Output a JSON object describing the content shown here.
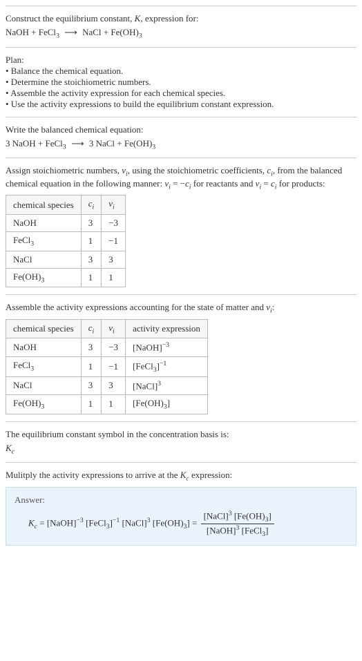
{
  "s1": {
    "line1_a": "Construct the equilibrium constant, ",
    "line1_b": ", expression for:",
    "K": "K",
    "eq_lhs1": "NaOH + FeCl",
    "eq_rhs1": "NaCl + Fe(OH)",
    "sub3": "3"
  },
  "s2": {
    "plan": "Plan:",
    "b1": "• Balance the chemical equation.",
    "b2": "• Determine the stoichiometric numbers.",
    "b3": "• Assemble the activity expression for each chemical species.",
    "b4": "• Use the activity expressions to build the equilibrium constant expression."
  },
  "s3": {
    "line1": "Write the balanced chemical equation:",
    "eq_lhs": "3 NaOH + FeCl",
    "eq_rhs": "3 NaCl + Fe(OH)",
    "sub3": "3"
  },
  "s4": {
    "line1a": "Assign stoichiometric numbers, ",
    "nu_i": "ν",
    "line1b": ", using the stoichiometric coefficients, ",
    "c_i": "c",
    "line1c": ", from the balanced chemical equation in the following manner: ",
    "rel_reactants_a": " = −",
    "line1d": " for reactants and ",
    "rel_products_a": " = ",
    "line1e": " for products:",
    "i": "i",
    "h1": "chemical species",
    "h2": "c",
    "h3": "ν",
    "r1": {
      "sp": "NaOH",
      "c": "3",
      "v": "−3"
    },
    "r2": {
      "sp_a": "FeCl",
      "c": "1",
      "v": "−1"
    },
    "r3": {
      "sp": "NaCl",
      "c": "3",
      "v": "3"
    },
    "r4": {
      "sp_a": "Fe(OH)",
      "c": "1",
      "v": "1"
    },
    "sub3": "3"
  },
  "s5": {
    "line1a": "Assemble the activity expressions accounting for the state of matter and ",
    "line1b": ":",
    "nu": "ν",
    "i": "i",
    "h1": "chemical species",
    "h2": "c",
    "h3": "ν",
    "h4": "activity expression",
    "r1": {
      "sp": "NaOH",
      "c": "3",
      "v": "−3",
      "ae_base": "[NaOH]",
      "ae_exp": "−3"
    },
    "r2": {
      "sp_a": "FeCl",
      "c": "1",
      "v": "−1",
      "ae_base_a": "[FeCl",
      "ae_base_b": "]",
      "ae_exp": "−1"
    },
    "r3": {
      "sp": "NaCl",
      "c": "3",
      "v": "3",
      "ae_base": "[NaCl]",
      "ae_exp": "3"
    },
    "r4": {
      "sp_a": "Fe(OH)",
      "c": "1",
      "v": "1",
      "ae_base_a": "[Fe(OH)",
      "ae_base_b": "]"
    },
    "sub3": "3"
  },
  "s6": {
    "line1": "The equilibrium constant symbol in the concentration basis is:",
    "Kc": "K",
    "c": "c"
  },
  "s7": {
    "line1a": "Mulitply the activity expressions to arrive at the ",
    "K": "K",
    "c": "c",
    "line1b": " expression:"
  },
  "ans": {
    "label": "Answer:",
    "Kc": "K",
    "c": "c",
    "eq_sign": " = ",
    "t1_base": "[NaOH]",
    "t1_exp": "−3",
    "t2_base_a": " [FeCl",
    "t2_base_b": "]",
    "t2_exp": "−1",
    "t3_base": " [NaCl]",
    "t3_exp": "3",
    "t4_base_a": " [Fe(OH)",
    "t4_base_b": "]",
    "num_a": "[NaCl]",
    "num_exp": "3",
    "num_b": " [Fe(OH)",
    "num_c": "]",
    "den_a": "[NaOH]",
    "den_exp": "3",
    "den_b": " [FeCl",
    "den_c": "]",
    "sub3": "3"
  },
  "arrow": "⟶"
}
